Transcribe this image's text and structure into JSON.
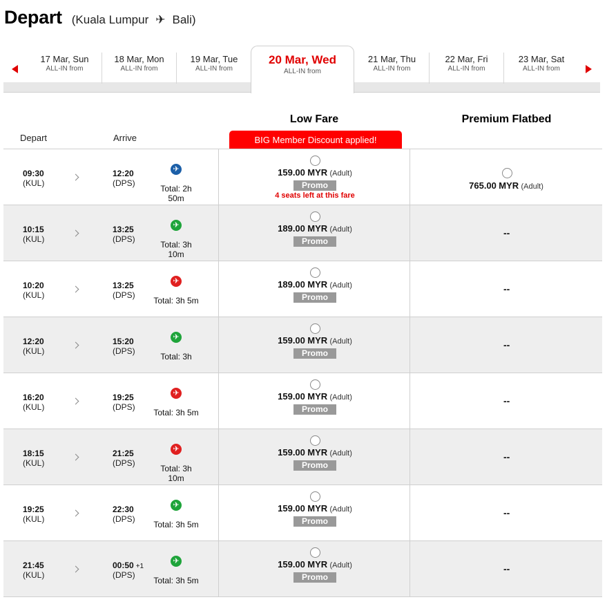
{
  "header": {
    "title": "Depart",
    "route_open": "(Kuala Lumpur",
    "route_close": "Bali)",
    "plane_icon": "airplane-icon"
  },
  "dates": [
    {
      "date": "17 Mar, Sun",
      "sub": "ALL-IN from",
      "active": false
    },
    {
      "date": "18 Mar, Mon",
      "sub": "ALL-IN from",
      "active": false
    },
    {
      "date": "19 Mar, Tue",
      "sub": "ALL-IN from",
      "active": false
    },
    {
      "date": "20 Mar, Wed",
      "sub": "ALL-IN from",
      "active": true
    },
    {
      "date": "21 Mar, Thu",
      "sub": "ALL-IN from",
      "active": false
    },
    {
      "date": "22 Mar, Fri",
      "sub": "ALL-IN from",
      "active": false
    },
    {
      "date": "23 Mar, Sat",
      "sub": "ALL-IN from",
      "active": false
    }
  ],
  "columns": {
    "depart": "Depart",
    "arrive": "Arrive",
    "low_fare": "Low Fare",
    "premium": "Premium Flatbed",
    "discount_banner": "BIG Member Discount applied!"
  },
  "colors": {
    "accent": "#e00000",
    "promo_badge": "#999999",
    "row_alt": "#eeeeee",
    "plane_blue": "#1c5fa8",
    "plane_green": "#1ea43a",
    "plane_red": "#e02020"
  },
  "flights": [
    {
      "dep_time": "09:30",
      "dep_ap": "(KUL)",
      "arr_time": "12:20",
      "arr_plus": "",
      "arr_ap": "(DPS)",
      "plane": "blue",
      "total": "Total: 2h 50m",
      "price": "159.00",
      "currency": "MYR",
      "pax": "(Adult)",
      "promo": "Promo",
      "seats": "4 seats left at this fare",
      "premium_price": "765.00",
      "premium_currency": "MYR",
      "premium_pax": "(Adult)",
      "premium": ""
    },
    {
      "dep_time": "10:15",
      "dep_ap": "(KUL)",
      "arr_time": "13:25",
      "arr_plus": "",
      "arr_ap": "(DPS)",
      "plane": "green",
      "total": "Total: 3h 10m",
      "price": "189.00",
      "currency": "MYR",
      "pax": "(Adult)",
      "promo": "Promo",
      "seats": "",
      "premium": "--"
    },
    {
      "dep_time": "10:20",
      "dep_ap": "(KUL)",
      "arr_time": "13:25",
      "arr_plus": "",
      "arr_ap": "(DPS)",
      "plane": "red",
      "total": "Total: 3h 5m",
      "price": "189.00",
      "currency": "MYR",
      "pax": "(Adult)",
      "promo": "Promo",
      "seats": "",
      "premium": "--"
    },
    {
      "dep_time": "12:20",
      "dep_ap": "(KUL)",
      "arr_time": "15:20",
      "arr_plus": "",
      "arr_ap": "(DPS)",
      "plane": "green",
      "total": "Total: 3h",
      "price": "159.00",
      "currency": "MYR",
      "pax": "(Adult)",
      "promo": "Promo",
      "seats": "",
      "premium": "--"
    },
    {
      "dep_time": "16:20",
      "dep_ap": "(KUL)",
      "arr_time": "19:25",
      "arr_plus": "",
      "arr_ap": "(DPS)",
      "plane": "red",
      "total": "Total: 3h 5m",
      "price": "159.00",
      "currency": "MYR",
      "pax": "(Adult)",
      "promo": "Promo",
      "seats": "",
      "premium": "--"
    },
    {
      "dep_time": "18:15",
      "dep_ap": "(KUL)",
      "arr_time": "21:25",
      "arr_plus": "",
      "arr_ap": "(DPS)",
      "plane": "red",
      "total": "Total: 3h 10m",
      "price": "159.00",
      "currency": "MYR",
      "pax": "(Adult)",
      "promo": "Promo",
      "seats": "",
      "premium": "--"
    },
    {
      "dep_time": "19:25",
      "dep_ap": "(KUL)",
      "arr_time": "22:30",
      "arr_plus": "",
      "arr_ap": "(DPS)",
      "plane": "green",
      "total": "Total: 3h 5m",
      "price": "159.00",
      "currency": "MYR",
      "pax": "(Adult)",
      "promo": "Promo",
      "seats": "",
      "premium": "--"
    },
    {
      "dep_time": "21:45",
      "dep_ap": "(KUL)",
      "arr_time": "00:50",
      "arr_plus": "+1",
      "arr_ap": "(DPS)",
      "plane": "green",
      "total": "Total: 3h 5m",
      "price": "159.00",
      "currency": "MYR",
      "pax": "(Adult)",
      "promo": "Promo",
      "seats": "",
      "premium": "--"
    }
  ]
}
